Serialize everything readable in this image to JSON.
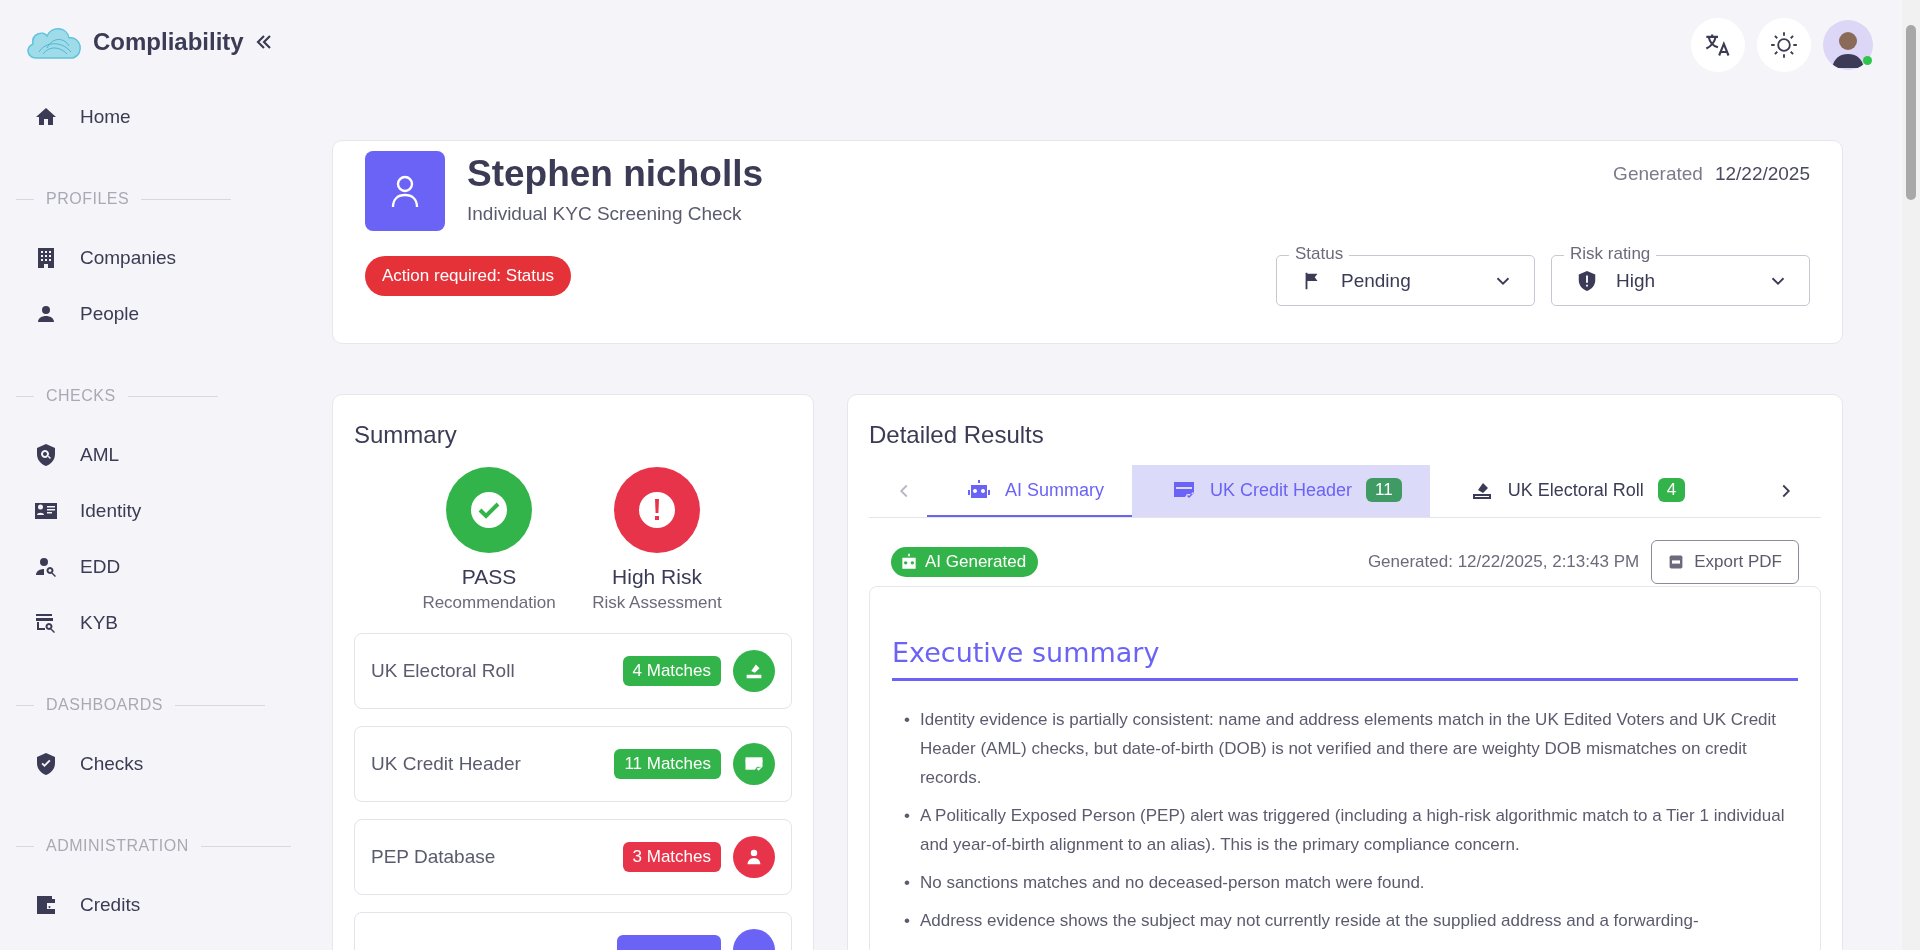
{
  "brand": {
    "name": "Compliability"
  },
  "sidebar": {
    "items": [
      {
        "label": "Home"
      }
    ],
    "sections": [
      {
        "title": "PROFILES",
        "items": [
          {
            "label": "Companies"
          },
          {
            "label": "People"
          }
        ]
      },
      {
        "title": "CHECKS",
        "items": [
          {
            "label": "AML"
          },
          {
            "label": "Identity"
          },
          {
            "label": "EDD"
          },
          {
            "label": "KYB"
          }
        ]
      },
      {
        "title": "DASHBOARDS",
        "items": [
          {
            "label": "Checks"
          }
        ]
      },
      {
        "title": "ADMINISTRATION",
        "items": [
          {
            "label": "Credits"
          }
        ]
      }
    ]
  },
  "topbar": {
    "avatar_online": true
  },
  "profile": {
    "name": "Stephen nicholls",
    "subtitle": "Individual KYC Screening Check",
    "generated_label": "Generated",
    "generated_date": "12/22/2025",
    "alert": "Action required: Status",
    "selects": [
      {
        "label": "Status",
        "value": "Pending"
      },
      {
        "label": "Risk rating",
        "value": "High"
      }
    ]
  },
  "summary": {
    "title": "Summary",
    "verdicts": [
      {
        "kind": "pass",
        "value": "PASS",
        "caption": "Recommendation",
        "color": "#33b44a"
      },
      {
        "kind": "alert",
        "value": "High Risk",
        "caption": "Risk Assessment",
        "color": "#e8344a"
      }
    ],
    "checks": [
      {
        "name": "UK Electoral Roll",
        "count": "4 Matches",
        "color": "#33b44a"
      },
      {
        "name": "UK Credit Header",
        "count": "11 Matches",
        "color": "#33b44a"
      },
      {
        "name": "PEP Database",
        "count": "3 Matches",
        "color": "#e8344a"
      },
      {
        "color": "#6b63f5"
      }
    ]
  },
  "details": {
    "title": "Detailed Results",
    "tabs": [
      {
        "label": "AI Summary",
        "selected": true,
        "hovered": false
      },
      {
        "label": "UK Credit Header",
        "count": "11",
        "color": "#3f9a64",
        "selected": false,
        "hovered": true
      },
      {
        "label": "UK Electoral Roll",
        "count": "4",
        "color": "#33b44a",
        "selected": false,
        "hovered": false
      }
    ],
    "badge": "AI Generated",
    "generated": "Generated: 12/22/2025, 2:13:43 PM",
    "export_button": "Export PDF",
    "heading": "Executive summary",
    "bullets": [
      {
        "marker": "•",
        "text": "Identity evidence is partially consistent: name and address elements match in the UK Edited Voters and UK Credit Header (AML) checks, but date-of-birth (DOB) is not verified and there are weighty DOB mismatches on credit records."
      },
      {
        "marker": "•",
        "text": "A Politically Exposed Person (PEP) alert was triggered (including a high-risk algorithmic match to a Tier 1 individual and year-of-birth alignment to an alias). This is the primary compliance concern."
      },
      {
        "marker": "•",
        "text": "No sanctions matches and no deceased-person match were found."
      },
      {
        "marker": "•",
        "text": "Address evidence shows the subject may not currently reside at the supplied address and a forwarding-"
      }
    ]
  }
}
